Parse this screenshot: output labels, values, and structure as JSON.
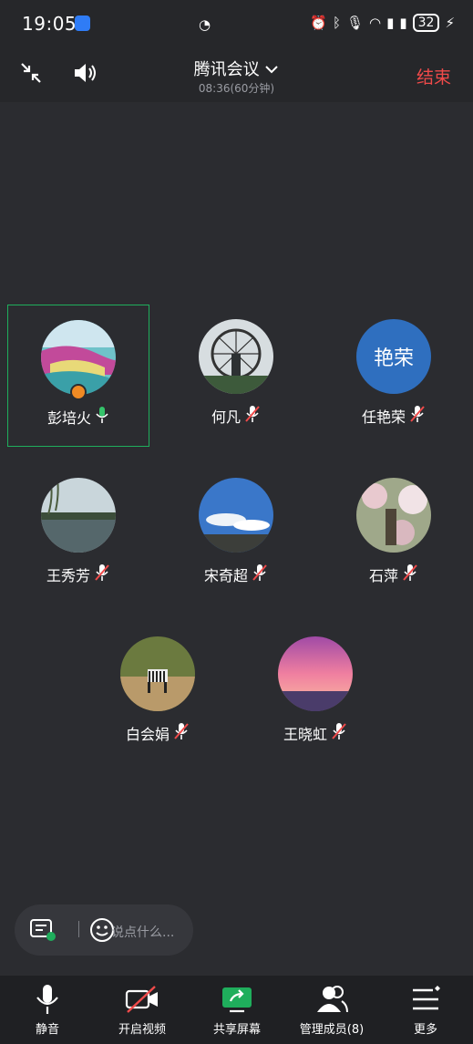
{
  "status": {
    "time": "19:05",
    "battery": "32"
  },
  "header": {
    "title": "腾讯会议",
    "subtitle": "08:36(60分钟)",
    "end_label": "结束"
  },
  "participants": [
    {
      "name": "彭培火",
      "avatar": "photo-garden",
      "mic": "on",
      "host": true
    },
    {
      "name": "何凡",
      "avatar": "photo-wheel",
      "mic": "off"
    },
    {
      "name": "任艳荣",
      "avatar_text": "艳荣",
      "mic": "off"
    },
    {
      "name": "王秀芳",
      "avatar": "photo-lake",
      "mic": "off"
    },
    {
      "name": "宋奇超",
      "avatar": "photo-sky",
      "mic": "off"
    },
    {
      "name": "石萍",
      "avatar": "photo-flowers",
      "mic": "off"
    },
    {
      "name": "白会娟",
      "avatar": "photo-zebra",
      "mic": "off"
    },
    {
      "name": "王晓虹",
      "avatar": "photo-sunset",
      "mic": "off"
    }
  ],
  "chat": {
    "placeholder": "说点什么..."
  },
  "toolbar": {
    "mute_label": "静音",
    "video_label": "开启视频",
    "share_label": "共享屏幕",
    "members_label": "管理成员(8)",
    "more_label": "更多"
  },
  "colors": {
    "accent_green": "#1fae5c",
    "end_red": "#f04a4a",
    "host_orange": "#f08a24"
  }
}
